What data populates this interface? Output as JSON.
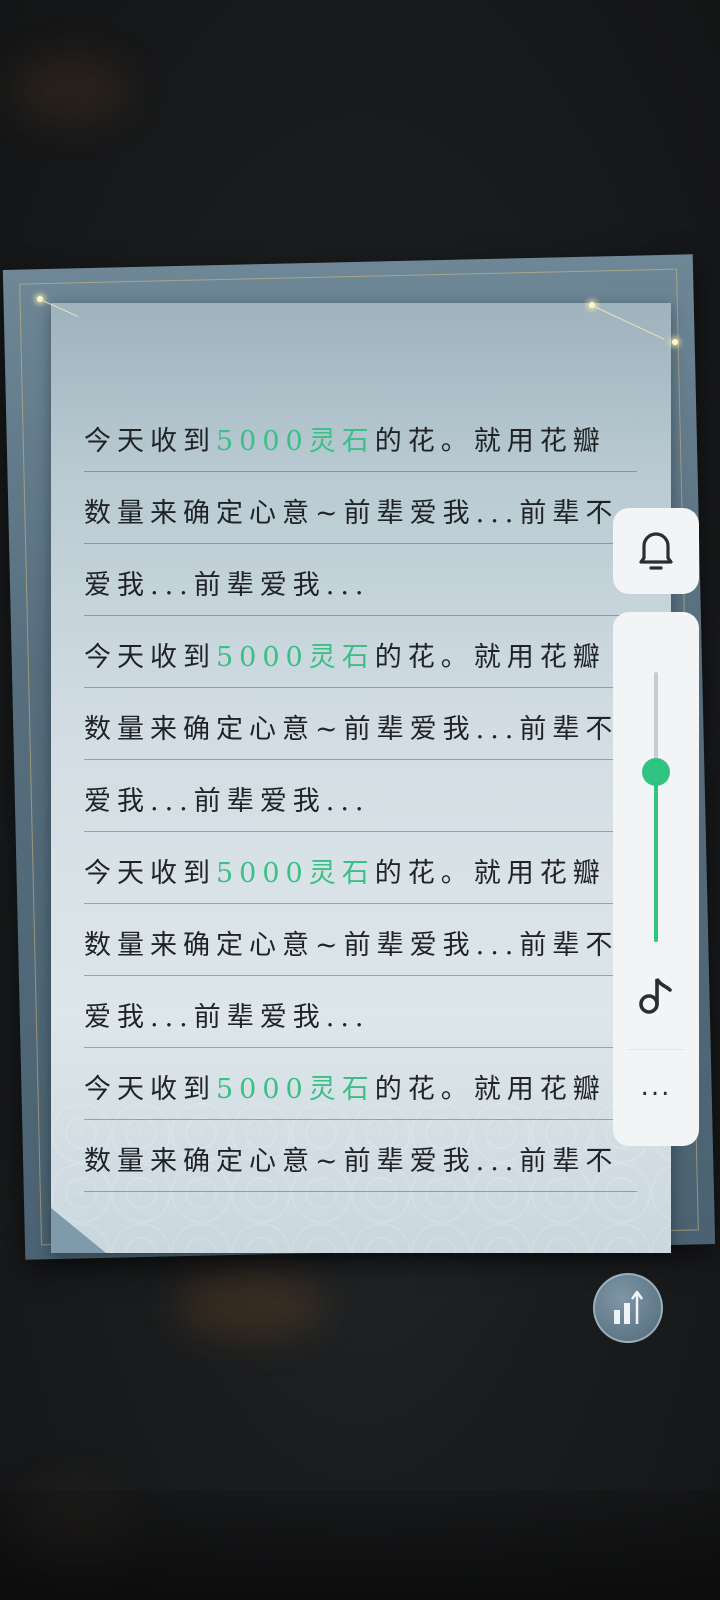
{
  "letter": {
    "lines": [
      {
        "before": "今天收到",
        "highlight": "5000灵石",
        "after": "的花。就用花瓣"
      },
      {
        "before": "数量来确定心意~前辈爱我...前辈不",
        "highlight": "",
        "after": ""
      },
      {
        "before": "爱我...前辈爱我...",
        "highlight": "",
        "after": ""
      },
      {
        "before": "今天收到",
        "highlight": "5000灵石",
        "after": "的花。就用花瓣"
      },
      {
        "before": "数量来确定心意~前辈爱我...前辈不",
        "highlight": "",
        "after": ""
      },
      {
        "before": "爱我...前辈爱我...",
        "highlight": "",
        "after": ""
      },
      {
        "before": "今天收到",
        "highlight": "5000灵石",
        "after": "的花。就用花瓣"
      },
      {
        "before": "数量来确定心意~前辈爱我...前辈不",
        "highlight": "",
        "after": ""
      },
      {
        "before": "爱我...前辈爱我...",
        "highlight": "",
        "after": ""
      },
      {
        "before": "今天收到",
        "highlight": "5000灵石",
        "after": "的花。就用花瓣"
      },
      {
        "before": "数量来确定心意~前辈爱我...前辈不",
        "highlight": "",
        "after": ""
      }
    ],
    "highlight_color": "#3bbf86"
  },
  "controls": {
    "notify_icon": "bell-icon",
    "volume_level": 0.63,
    "accent_color": "#2fc482",
    "music_icon": "music-note-icon",
    "more_label": "...",
    "stats_icon": "bar-chart-up-icon"
  }
}
